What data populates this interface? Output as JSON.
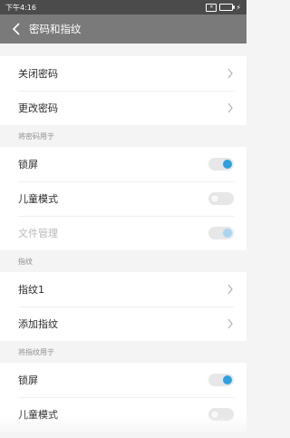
{
  "status_bar": {
    "time": "下午4:16",
    "sim": "✕"
  },
  "header": {
    "title": "密码和指纹"
  },
  "password_group": [
    {
      "label": "关闭密码"
    },
    {
      "label": "更改密码"
    }
  ],
  "use_password_section": {
    "title": "将密码用于",
    "items": [
      {
        "label": "锁屏",
        "state": "on"
      },
      {
        "label": "儿童模式",
        "state": "off"
      },
      {
        "label": "文件管理",
        "state": "disabled-on"
      }
    ]
  },
  "fingerprint_section": {
    "title": "指纹",
    "items": [
      {
        "label": "指纹1"
      },
      {
        "label": "添加指纹"
      }
    ]
  },
  "use_fingerprint_section": {
    "title": "将指纹用于",
    "items": [
      {
        "label": "锁屏",
        "state": "on"
      },
      {
        "label": "儿童模式",
        "state": "off"
      }
    ]
  },
  "colors": {
    "accent": "#2fa0e0",
    "titlebar": "#7a7a7a",
    "statusbar": "#4b4b4b"
  }
}
